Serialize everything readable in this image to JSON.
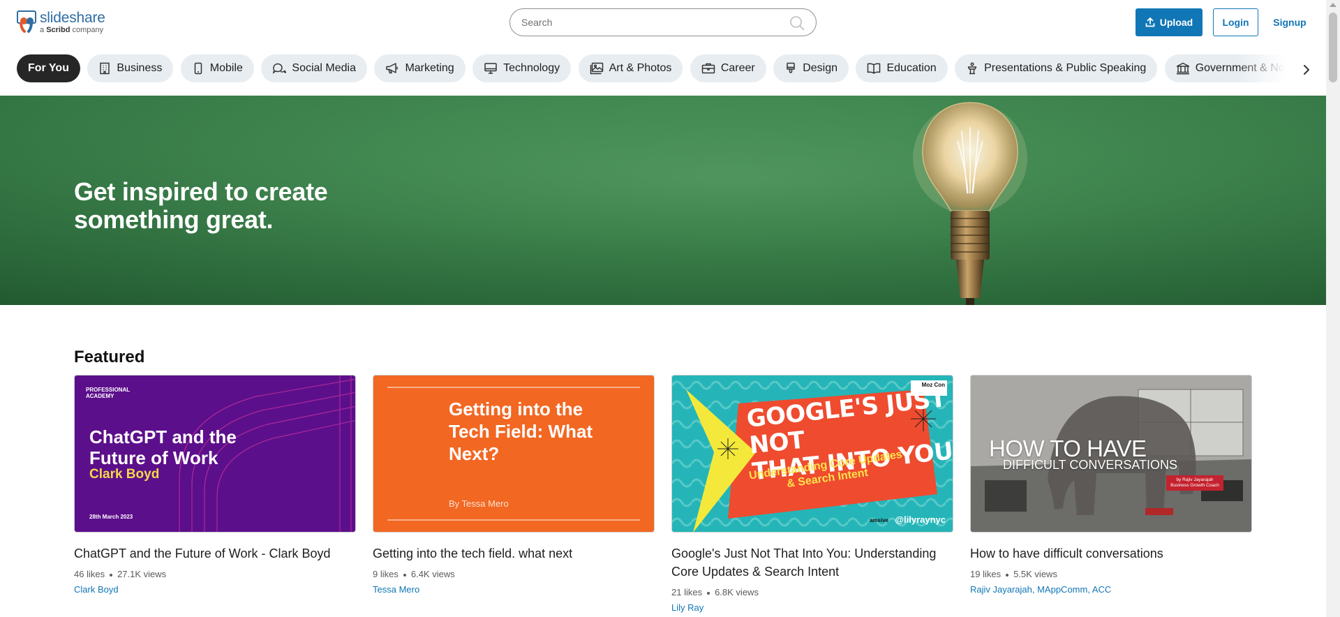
{
  "header": {
    "logo_name": "slideshare",
    "logo_sub_prefix": "a ",
    "logo_sub_brand": "Scribd",
    "logo_sub_suffix": " company",
    "search_placeholder": "Search",
    "upload_label": "Upload",
    "login_label": "Login",
    "signup_label": "Signup"
  },
  "categories": [
    {
      "label": "For You",
      "icon": "none",
      "active": true
    },
    {
      "label": "Business",
      "icon": "building-icon"
    },
    {
      "label": "Mobile",
      "icon": "mobile-icon"
    },
    {
      "label": "Social Media",
      "icon": "chat-bubbles-icon"
    },
    {
      "label": "Marketing",
      "icon": "megaphone-icon"
    },
    {
      "label": "Technology",
      "icon": "monitor-icon"
    },
    {
      "label": "Art & Photos",
      "icon": "image-icon"
    },
    {
      "label": "Career",
      "icon": "briefcase-icon"
    },
    {
      "label": "Design",
      "icon": "paintbrush-icon"
    },
    {
      "label": "Education",
      "icon": "book-icon"
    },
    {
      "label": "Presentations & Public Speaking",
      "icon": "podium-icon"
    },
    {
      "label": "Government & Nonprofit",
      "icon": "government-building-icon"
    }
  ],
  "hero": {
    "line1": "Get inspired to create",
    "line2": "something great."
  },
  "featured": {
    "title": "Featured",
    "cards": [
      {
        "title": "ChatGPT and the Future of Work - Clark Boyd",
        "likes": "46 likes",
        "views": "27.1K views",
        "author": "Clark Boyd",
        "thumb": {
          "badge1": "PROFESSIONAL",
          "badge2": "ACADEMY",
          "h1": "ChatGPT and the",
          "h2": "Future of Work",
          "sub": "Clark Boyd",
          "date": "28th March 2023"
        }
      },
      {
        "title": "Getting into the tech field. what next",
        "likes": "9 likes",
        "views": "6.4K views",
        "author": "Tessa Mero",
        "thumb": {
          "h1": "Getting into the",
          "h2": "Tech Field: What",
          "h3": "Next?",
          "by": "By Tessa Mero"
        }
      },
      {
        "title": "Google's Just Not That Into You: Understanding Core Updates & Search Intent",
        "likes": "21 likes",
        "views": "6.8K views",
        "author": "Lily Ray",
        "thumb": {
          "h1": "GOOGLE'S JUST NOT",
          "h2": "THAT INTO YOU",
          "s1": "Understanding Core Updates",
          "s2": "& Search Intent",
          "mark": "Moz Con",
          "handle": "@lilyraynyc",
          "amsive": "amsive"
        }
      },
      {
        "title": "How to have difficult conversations",
        "likes": "19 likes",
        "views": "5.5K views",
        "author": "Rajiv Jayarajah, MAppComm, ACC",
        "thumb": {
          "h1": "HOW TO HAVE",
          "h2": "DIFFICULT CONVERSATIONS",
          "tag1": "by Rajiv Jayarajah",
          "tag2": "Business Growth Coach"
        }
      }
    ]
  },
  "colors": {
    "brand_blue": "#1176b5",
    "chip_bg": "#e8edf1",
    "chip_active_bg": "#262626",
    "hero_green": "#3f8a4f"
  }
}
